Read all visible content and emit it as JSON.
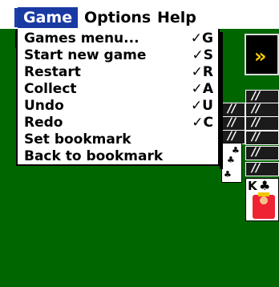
{
  "menubar": {
    "items": [
      {
        "label": "Game",
        "active": true
      },
      {
        "label": "Options",
        "active": false
      },
      {
        "label": "Help",
        "active": false
      }
    ]
  },
  "dropdown": {
    "items": [
      {
        "label": "Games menu...",
        "shortcut": "✓G"
      },
      {
        "label": "Start new game",
        "shortcut": "✓S"
      },
      {
        "label": "Restart",
        "shortcut": "✓R"
      },
      {
        "label": "Collect",
        "shortcut": "✓A"
      },
      {
        "label": "Undo",
        "shortcut": "✓U"
      },
      {
        "label": "Redo",
        "shortcut": "✓C"
      },
      {
        "label": "Set bookmark",
        "shortcut": ""
      },
      {
        "label": "Back to bookmark",
        "shortcut": ""
      }
    ]
  },
  "cards": {
    "king": {
      "rank": "K",
      "suit": "♣"
    }
  },
  "colors": {
    "felt": "#006600",
    "menu_highlight": "#1a3aa3"
  }
}
